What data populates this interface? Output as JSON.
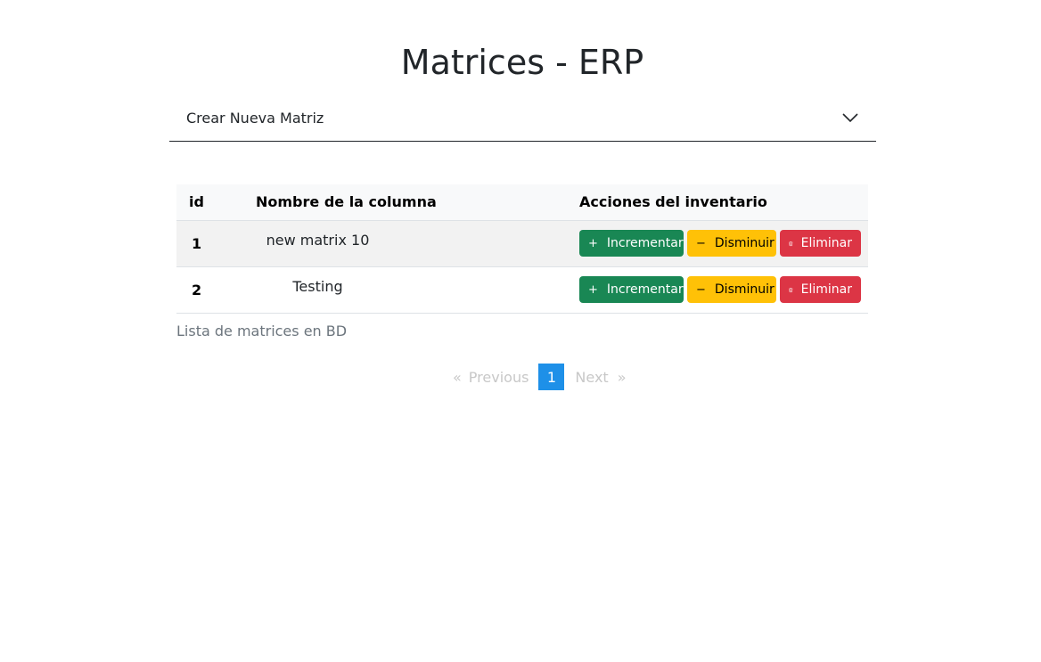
{
  "page": {
    "title": "Matrices - ERP"
  },
  "accordion": {
    "label": "Crear Nueva Matriz"
  },
  "table": {
    "headers": {
      "id": "id",
      "name": "Nombre de la columna",
      "actions": "Acciones del inventario"
    },
    "rows": [
      {
        "id": "1",
        "name": "new matrix 10"
      },
      {
        "id": "2",
        "name": "Testing"
      }
    ],
    "actions": {
      "increment": {
        "icon": "+",
        "label": "Incrementar"
      },
      "decrement": {
        "icon": "−",
        "label": "Disminuir"
      },
      "delete": {
        "label": "Eliminar"
      }
    },
    "caption": "Lista de matrices en BD"
  },
  "pagination": {
    "prev_arrow": "«",
    "prev_label": "Previous",
    "current": "1",
    "next_label": "Next",
    "next_arrow": "»"
  },
  "colors": {
    "success": "#198754",
    "warning": "#ffc107",
    "danger": "#dc3545",
    "pagination_active": "#1e90e8"
  }
}
